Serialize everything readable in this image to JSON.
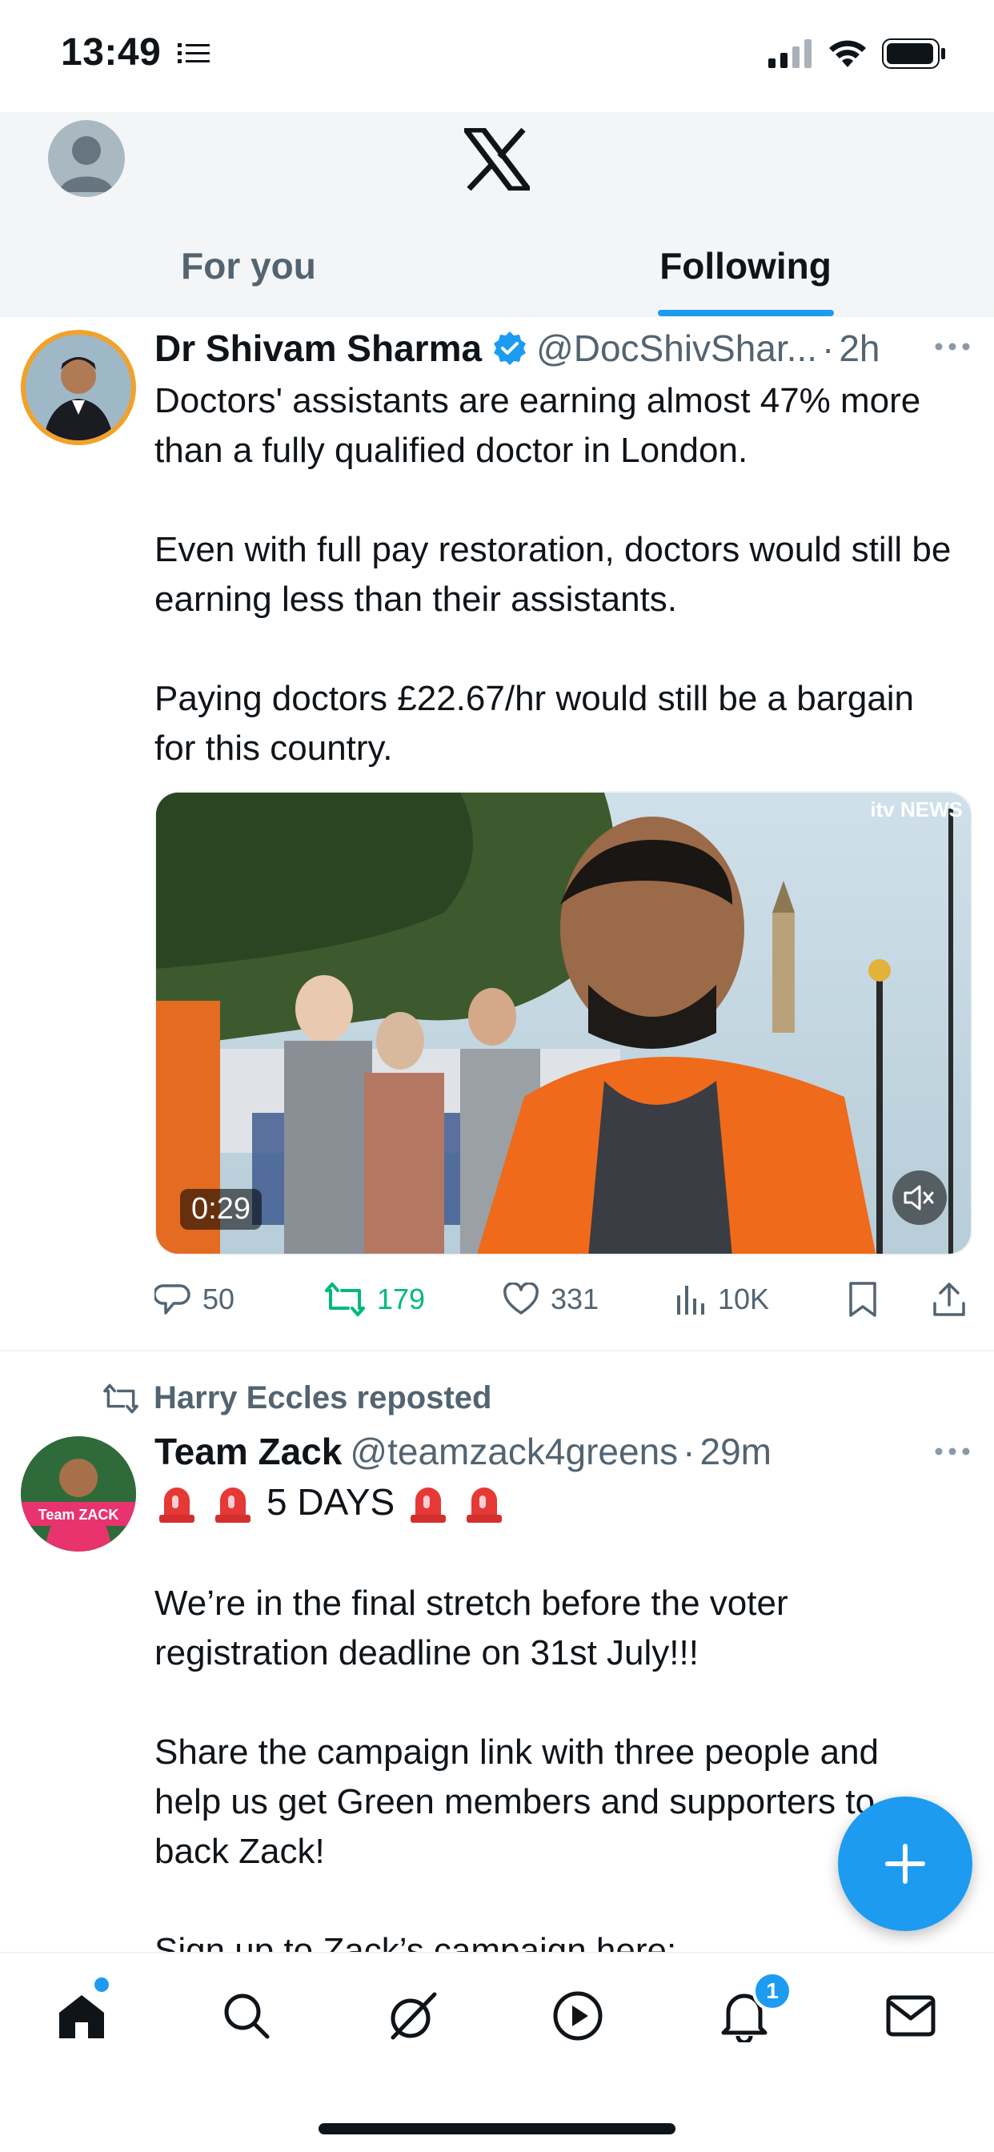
{
  "status_bar": {
    "time": "13:49"
  },
  "header": {
    "tabs": [
      {
        "label": "For you",
        "active": false
      },
      {
        "label": "Following",
        "active": true
      }
    ]
  },
  "tweets": [
    {
      "name": "Dr Shivam Sharma",
      "verified": true,
      "handle": "@DocShivShar...",
      "time": "2h",
      "text": "Doctors' assistants are earning almost 47% more than a fully qualified doctor in London.\n\nEven with full pay restoration, doctors would still be earning less than their assistants.\n\nPaying doctors £22.67/hr would still be a bargain for this country.",
      "video": {
        "duration": "0:29",
        "brand": "itv NEWS"
      },
      "stats": {
        "replies": "50",
        "reposts": "179",
        "likes": "331",
        "views": "10K"
      }
    },
    {
      "reposted_by": "Harry Eccles reposted",
      "name": "Team Zack",
      "handle": "@teamzack4greens",
      "time": "29m",
      "avatar_label": "Team ZACK",
      "emoji_line": "5 DAYS",
      "text": "We’re in the final stretch before the voter registration deadline on 31st July!!!\n\nShare the campaign link with three people and help us get Green members and supporters to back Zack!\n\nSign up to Zack’s campaign here:"
    }
  ],
  "nav": {
    "notifications_badge": "1"
  },
  "colors": {
    "accent": "#1d9bf0",
    "repost_green": "#00ba7c",
    "secondary_text": "#536471"
  }
}
